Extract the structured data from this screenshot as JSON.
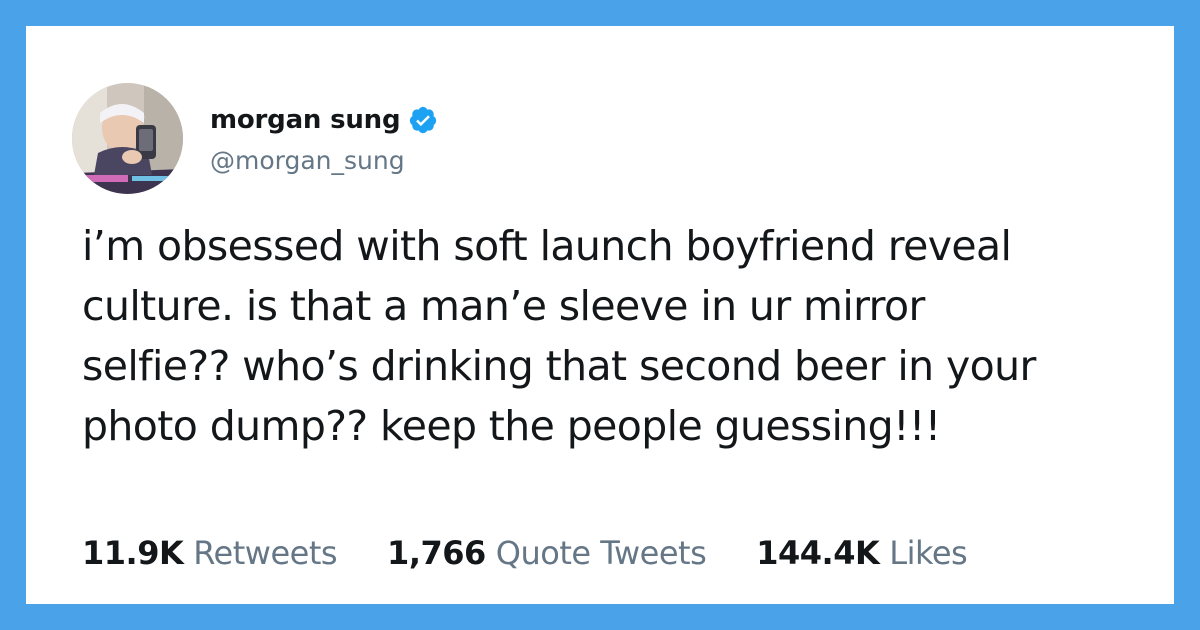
{
  "colors": {
    "frame": "#4aa3e8",
    "card": "#ffffff",
    "text": "#14171a",
    "muted": "#657786",
    "verified": "#1da1f2"
  },
  "author": {
    "name": "morgan sung",
    "handle": "@morgan_sung",
    "verified_icon": "verified-badge-icon"
  },
  "tweet": {
    "text": "i’m obsessed with soft launch boyfriend reveal\nculture. is that a man’e sleeve in ur mirror\nselfie?? who’s drinking that second beer in your\nphoto dump?? keep the people guessing!!!"
  },
  "stats": {
    "retweets": {
      "value": "11.9K",
      "label": "Retweets"
    },
    "quotes": {
      "value": "1,766",
      "label": "Quote Tweets"
    },
    "likes": {
      "value": "144.4K",
      "label": "Likes"
    }
  }
}
